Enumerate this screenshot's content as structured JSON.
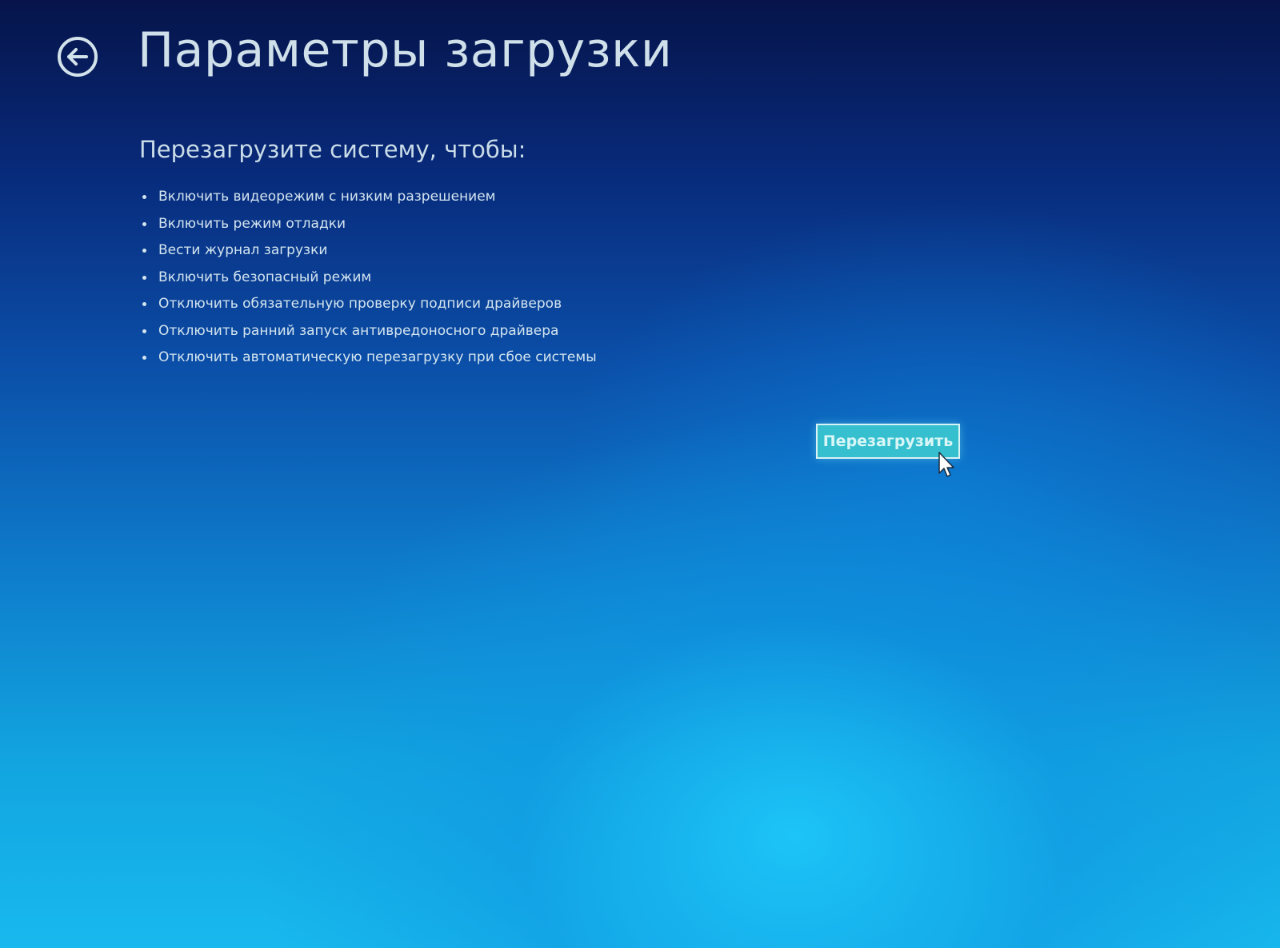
{
  "header": {
    "back_icon": "back-arrow-circle-icon",
    "title": "Параметры загрузки"
  },
  "main": {
    "subtitle": "Перезагрузите систему, чтобы:",
    "options": [
      "Включить видеорежим с низким разрешением",
      "Включить режим отладки",
      "Вести журнал загрузки",
      "Включить безопасный режим",
      "Отключить обязательную проверку подписи драйверов",
      "Отключить ранний запуск антивредоносного драйвера",
      "Отключить автоматическую перезагрузку при сбое системы"
    ],
    "restart_label": "Перезагрузить"
  },
  "colors": {
    "text": "#d3e5ef",
    "button_fill": "#36c0cf",
    "button_border": "#d8f2f6",
    "background_top": "#06144a",
    "background_bottom": "#18b9ee"
  }
}
